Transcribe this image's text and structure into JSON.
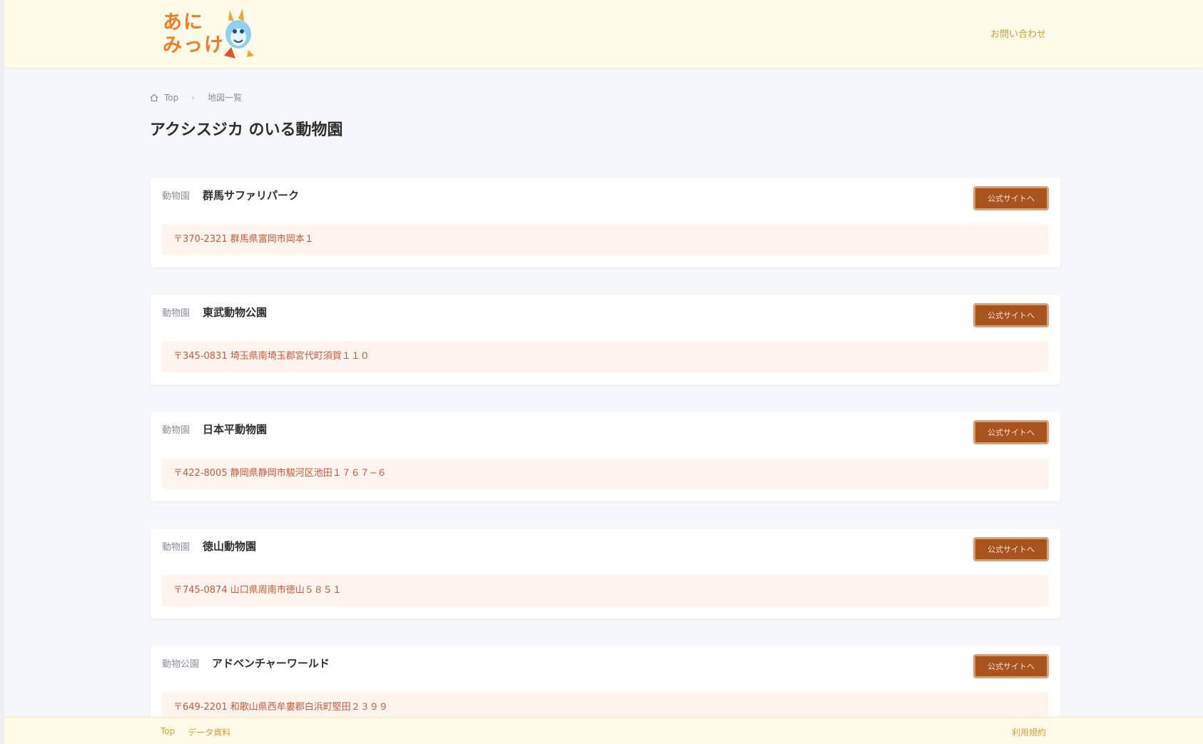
{
  "header": {
    "logo_text": "あに みっけ",
    "link_label": "お問い合わせ"
  },
  "breadcrumb": {
    "home_label": "Top",
    "current_label": "地図一覧"
  },
  "page": {
    "title": "アクシスジカ のいる動物園"
  },
  "card_common": {
    "name_label": "動物園",
    "button_label": "公式サイトへ"
  },
  "cards": [
    {
      "label": "動物園",
      "name": "群馬サファリパーク",
      "button": "公式サイトへ",
      "address": "〒370-2321 群馬県富岡市岡本１"
    },
    {
      "label": "動物園",
      "name": "東武動物公園",
      "button": "公式サイトへ",
      "address": "〒345-0831 埼玉県南埼玉郡宮代町須賀１１０"
    },
    {
      "label": "動物園",
      "name": "日本平動物園",
      "button": "公式サイトへ",
      "address": "〒422-8005 静岡県静岡市駿河区池田１７６７−６"
    },
    {
      "label": "動物園",
      "name": "徳山動物園",
      "button": "公式サイトへ",
      "address": "〒745-0874 山口県周南市徳山５８５１"
    },
    {
      "label": "動物公園",
      "name": "アドベンチャーワールド",
      "button": "公式サイトへ",
      "address": "〒649-2201 和歌山県西牟婁郡白浜町堅田２３９９"
    }
  ],
  "footer": {
    "top_label": "Top",
    "data_label": "データ資料",
    "right_label": "利用規約"
  },
  "colors": {
    "header_bg": "#fffbe6",
    "button_bg": "#a9531d",
    "address_bg": "#fff4ee",
    "address_text": "#c45b3a",
    "accent_link": "#c9a040"
  }
}
